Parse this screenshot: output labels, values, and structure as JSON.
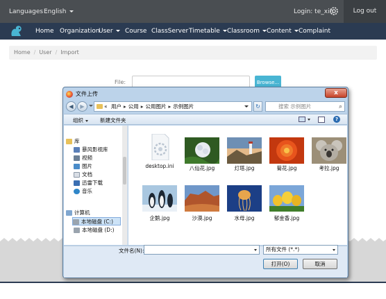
{
  "topbar": {
    "languages_label": "Languages :",
    "language_value": "English",
    "login_text": "Login: te_xin",
    "logout_label": "Log out"
  },
  "nav": {
    "items": [
      "Home",
      "Organization",
      "User",
      "Course",
      "ClassServer",
      "Timetable",
      "Classroom",
      "Content",
      "Complaint"
    ]
  },
  "breadcrumb": [
    "Home",
    "User",
    "Import"
  ],
  "form": {
    "file_label": "File:",
    "browse_label": "Browse..."
  },
  "dialog": {
    "title": "文件上传",
    "close_label": "x",
    "address": {
      "prefix": "«",
      "parts": [
        "用户",
        "公用",
        "公用图片",
        "示例图片"
      ]
    },
    "search_placeholder": "搜索 示例图片",
    "toolbar": {
      "organize": "组织",
      "new_folder": "新建文件夹"
    },
    "sidebar": {
      "library_header": "库",
      "libraries": [
        "暴风影视库",
        "视频",
        "图片",
        "文档",
        "迅雷下载",
        "音乐"
      ],
      "computer_header": "计算机",
      "drives": [
        "本地磁盘 (C:)",
        "本地磁盘 (D:)"
      ]
    },
    "files": [
      {
        "name": "desktop.ini",
        "icon": "settings-file-icon"
      },
      {
        "name": "八仙花.jpg",
        "icon": "hydrangea-thumbnail"
      },
      {
        "name": "灯塔.jpg",
        "icon": "lighthouse-thumbnail"
      },
      {
        "name": "菊花.jpg",
        "icon": "chrysanthemum-thumbnail"
      },
      {
        "name": "考拉.jpg",
        "icon": "koala-thumbnail"
      },
      {
        "name": "企鹅.jpg",
        "icon": "penguins-thumbnail"
      },
      {
        "name": "沙漠.jpg",
        "icon": "desert-thumbnail"
      },
      {
        "name": "水母.jpg",
        "icon": "jellyfish-thumbnail"
      },
      {
        "name": "郁金香.jpg",
        "icon": "tulips-thumbnail"
      }
    ],
    "filename_label": "文件名(N):",
    "filename_value": "",
    "filetype_value": "所有文件 (*.*)",
    "open_label": "打开(O)",
    "cancel_label": "取消"
  },
  "colors": {
    "topbar": "#4a4e52",
    "navbar": "#2b3b52",
    "browse": "#49b5d3",
    "dialog_frame": "#bcd3ea"
  }
}
